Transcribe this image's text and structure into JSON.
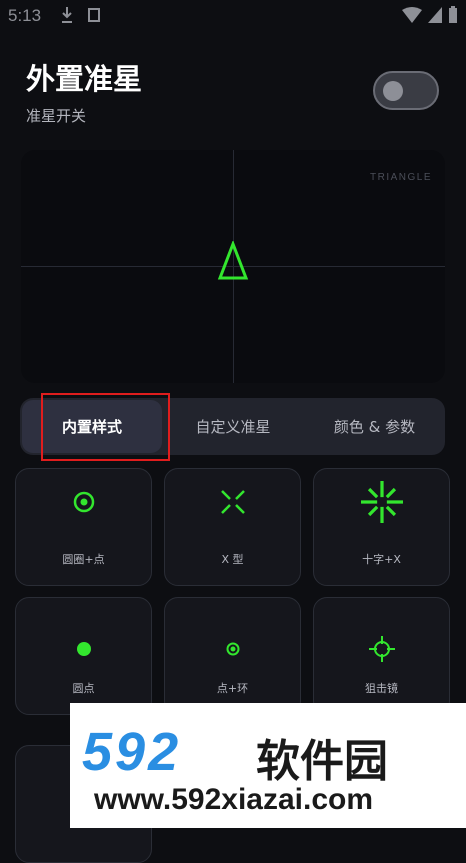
{
  "status_bar": {
    "time": "5:13"
  },
  "header": {
    "title": "外置准星",
    "subtitle": "准星开关"
  },
  "toggle": {
    "state": "off"
  },
  "preview": {
    "style_label": "TRIANGLE",
    "crosshair_color": "#33e62e"
  },
  "tabs": [
    {
      "label": "内置样式",
      "active": true
    },
    {
      "label": "自定义准星",
      "active": false
    },
    {
      "label": "颜色 & 参数",
      "active": false
    }
  ],
  "styles": [
    {
      "label": "圆圈+点",
      "icon": "circle-dot-icon"
    },
    {
      "label": "X 型",
      "icon": "x-shape-icon"
    },
    {
      "label": "十字+X",
      "icon": "cross-x-icon"
    },
    {
      "label": "圆点",
      "icon": "dot-icon"
    },
    {
      "label": "点+环",
      "icon": "dot-ring-icon"
    },
    {
      "label": "狙击镜",
      "icon": "scope-icon"
    }
  ],
  "watermark": {
    "logo": "592",
    "brand": "软件园",
    "url": "www.592xiazai.com"
  },
  "colors": {
    "accent_green": "#33e62e",
    "highlight_red": "#e01d1d",
    "watermark_blue": "#2a8ee2"
  }
}
